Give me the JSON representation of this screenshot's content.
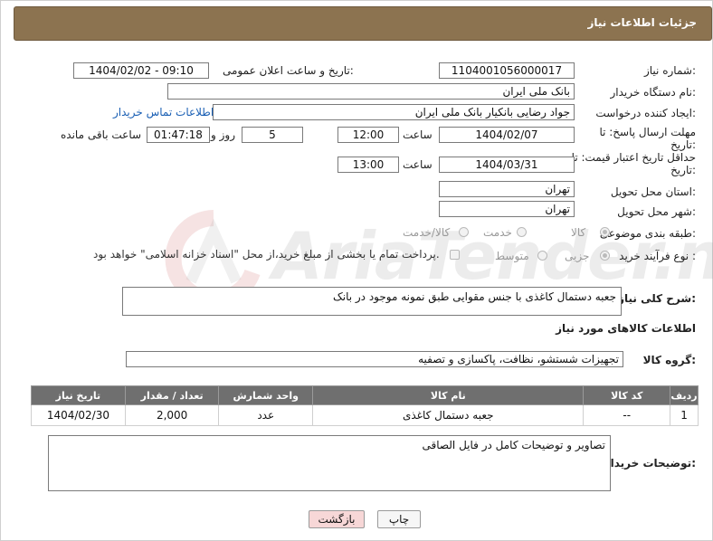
{
  "header": {
    "title": "جزئیات اطلاعات نیاز"
  },
  "watermark": {
    "brand": "AriaTender.neT",
    "sub": "TENDER"
  },
  "form": {
    "need_number_label": "شماره نیاز:",
    "need_number": "1104001056000017",
    "announce_label": "تاریخ و ساعت اعلان عمومی:",
    "announce_value": "1404/02/02 - 09:10",
    "buyer_label": "نام دستگاه خریدار:",
    "buyer": "بانک ملی ایران",
    "creator_label": "ایجاد کننده درخواست:",
    "creator": "جواد رضایی بانکیار بانک ملی ایران",
    "contact_link": "اطلاعات تماس خریدار",
    "deadline_label": "مهلت ارسال پاسخ: تا تاریخ:",
    "deadline_date": "1404/02/07",
    "time_label": "ساعت",
    "deadline_time": "12:00",
    "days_value": "5",
    "days_label": "روز و",
    "remaining_time": "01:47:18",
    "remaining_label": "ساعت باقی مانده",
    "validity_label": "حداقل تاریخ اعتبار قیمت: تا تاریخ:",
    "validity_date": "1404/03/31",
    "validity_time_label": "ساعت",
    "validity_time": "13:00",
    "province_label": "استان محل تحویل:",
    "province": "تهران",
    "city_label": "شهر محل تحویل:",
    "city": "تهران",
    "category_label": "طبقه بندی موضوعی:",
    "category_options": [
      "کالا",
      "خدمت",
      "کالا/خدمت"
    ],
    "process_label": "نوع فرآیند خرید :",
    "process_options": [
      "جزیی",
      "متوسط"
    ],
    "payment_note": "پرداخت تمام یا بخشی از مبلغ خرید،از محل \"اسناد خزانه اسلامی\" خواهد بود.",
    "description_label": "شرح کلی نیاز:",
    "description": "جعبه دستمال کاغذی با جنس مقوایی طبق نمونه موجود در بانک"
  },
  "goods_section": {
    "title": "اطلاعات کالاهای مورد نیاز",
    "group_label": "گروه کالا:",
    "group_value": "تجهیزات شستشو، نظافت، پاکسازی و تصفیه"
  },
  "table": {
    "headers": [
      "ردیف",
      "کد کالا",
      "نام کالا",
      "واحد شمارش",
      "تعداد / مقدار",
      "تاریخ نیاز"
    ],
    "rows": [
      [
        "1",
        "--",
        "جعبه دستمال کاغذی",
        "عدد",
        "2,000",
        "1404/02/30"
      ]
    ]
  },
  "buyer_notes": {
    "label": "توضیحات خریدار:",
    "value": "تصاویر و توضیحات کامل در فایل الصاقی"
  },
  "buttons": {
    "print": "چاپ",
    "back": "بازگشت"
  }
}
